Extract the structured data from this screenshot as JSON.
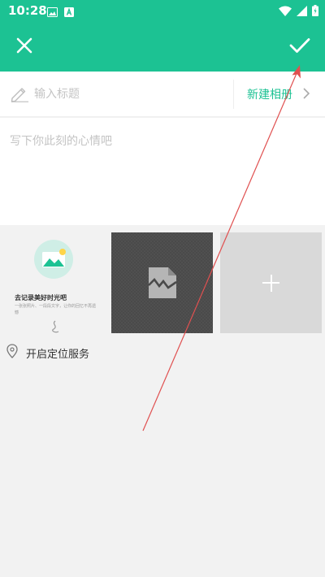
{
  "status_bar": {
    "time": "10:28"
  },
  "title_field": {
    "placeholder": "输入标题",
    "value": ""
  },
  "album": {
    "label": "新建相册"
  },
  "content_field": {
    "placeholder": "写下你此刻的心情吧",
    "value": ""
  },
  "prompt": {
    "title": "去记录美好时光吧",
    "description": "一张张照片、一段段文字，让你的回忆不再遗憾"
  },
  "location": {
    "label": "开启定位服务"
  },
  "colors": {
    "accent": "#1cc293",
    "annotation": "#e05050"
  },
  "icons": {
    "close": "close-icon",
    "confirm": "check-icon",
    "title": "pencil-icon",
    "album": "chevron-right-icon",
    "broken_image": "broken-image-icon",
    "add": "plus-icon",
    "location": "location-pin-icon"
  }
}
